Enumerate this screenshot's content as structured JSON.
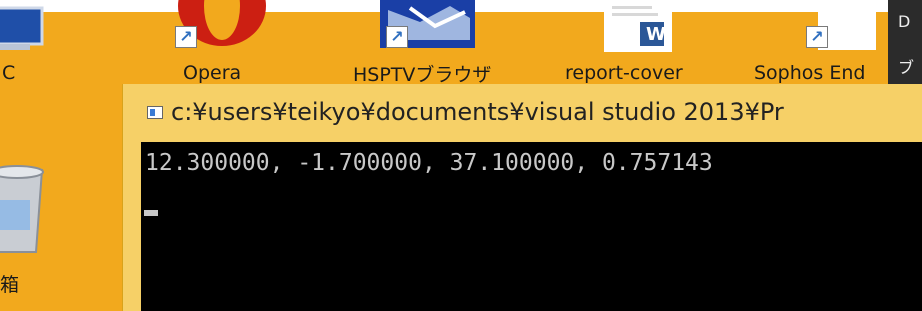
{
  "desktop": {
    "icons": [
      {
        "label": "C"
      },
      {
        "label": "Opera"
      },
      {
        "label": "HSPTVブラウザ"
      },
      {
        "label": "report-cover"
      },
      {
        "label": "Sophos End"
      },
      {
        "label": "箱"
      }
    ],
    "word_badge": "W",
    "right_strip_chars": [
      "D",
      "ブ"
    ]
  },
  "console_window": {
    "title": "c:¥users¥teikyo¥documents¥visual studio 2013¥Pr",
    "output_line": "12.300000, -1.700000, 37.100000, 0.757143"
  },
  "colors": {
    "desktop_bg": "#f2a91d",
    "window_frame": "#f6d067",
    "console_bg": "#000000",
    "console_text": "#c8c8c8"
  }
}
